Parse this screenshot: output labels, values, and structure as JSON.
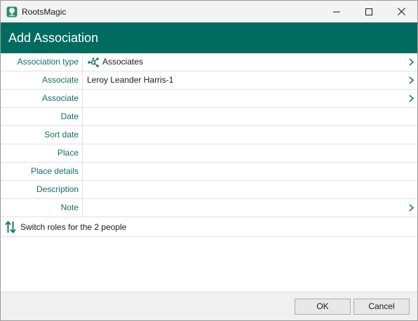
{
  "window": {
    "title": "RootsMagic"
  },
  "header": {
    "title": "Add Association"
  },
  "fields": [
    {
      "label": "Association type",
      "value": "Associates"
    },
    {
      "label": "Associate",
      "value": "Leroy Leander Harris-1"
    },
    {
      "label": "Associate",
      "value": ""
    },
    {
      "label": "Date",
      "value": ""
    },
    {
      "label": "Sort date",
      "value": ""
    },
    {
      "label": "Place",
      "value": ""
    },
    {
      "label": "Place details",
      "value": ""
    },
    {
      "label": "Description",
      "value": ""
    },
    {
      "label": "Note",
      "value": ""
    }
  ],
  "switch_roles": {
    "label": "Switch roles for the 2 people"
  },
  "buttons": {
    "ok": "OK",
    "cancel": "Cancel"
  },
  "colors": {
    "header_bg": "#006b5f",
    "label_text": "#0f6f64",
    "accent": "#117a6e"
  }
}
